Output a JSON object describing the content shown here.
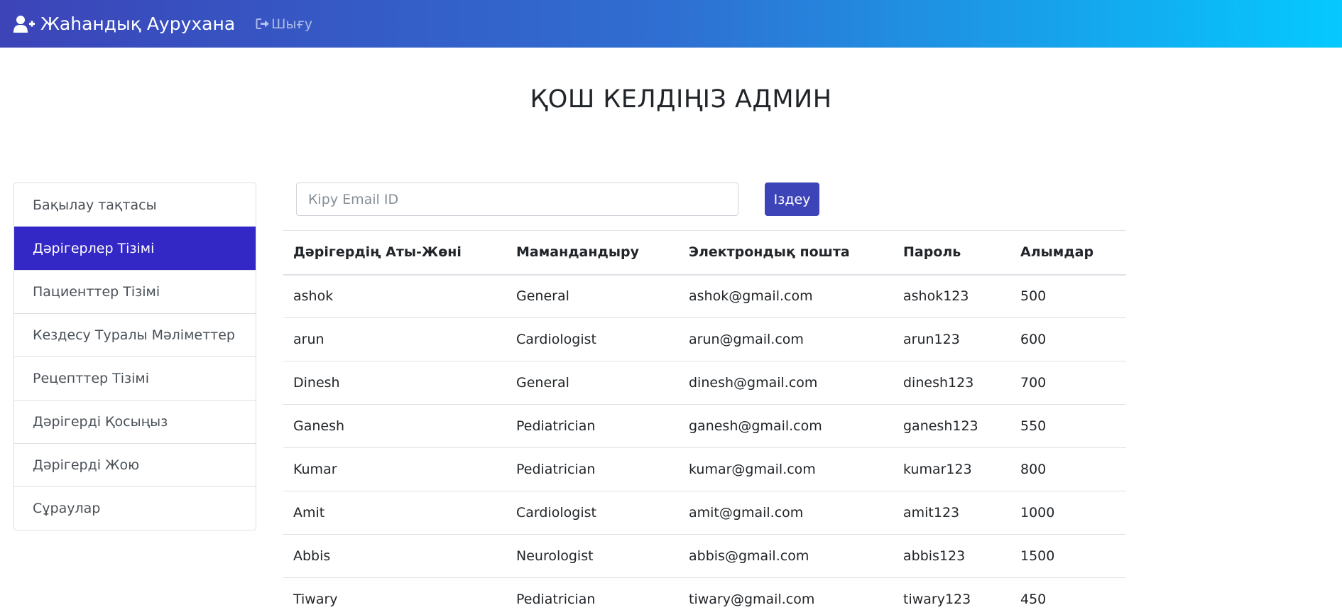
{
  "navbar": {
    "brand": "Жаһандық Аурухана",
    "logout": "Шығу"
  },
  "welcome": "ҚОШ КЕЛДІҢІЗ АДМИН",
  "sidebar": {
    "items": [
      {
        "label": "Бақылау тақтасы",
        "active": false
      },
      {
        "label": "Дәрігерлер Тізімі",
        "active": true
      },
      {
        "label": "Пациенттер Тізімі",
        "active": false
      },
      {
        "label": "Кездесу Туралы Мәліметтер",
        "active": false
      },
      {
        "label": "Рецепттер Тізімі",
        "active": false
      },
      {
        "label": "Дәрігерді Қосыңыз",
        "active": false
      },
      {
        "label": "Дәрігерді Жою",
        "active": false
      },
      {
        "label": "Сұраулар",
        "active": false
      }
    ]
  },
  "search": {
    "placeholder": "Кіру Email ID",
    "value": "",
    "button": "Іздеу"
  },
  "table": {
    "headers": [
      "Дәрігердің Аты-Жөні",
      "Мамандандыру",
      "Электрондық пошта",
      "Пароль",
      "Алымдар"
    ],
    "rows": [
      [
        "ashok",
        "General",
        "ashok@gmail.com",
        "ashok123",
        "500"
      ],
      [
        "arun",
        "Cardiologist",
        "arun@gmail.com",
        "arun123",
        "600"
      ],
      [
        "Dinesh",
        "General",
        "dinesh@gmail.com",
        "dinesh123",
        "700"
      ],
      [
        "Ganesh",
        "Pediatrician",
        "ganesh@gmail.com",
        "ganesh123",
        "550"
      ],
      [
        "Kumar",
        "Pediatrician",
        "kumar@gmail.com",
        "kumar123",
        "800"
      ],
      [
        "Amit",
        "Cardiologist",
        "amit@gmail.com",
        "amit123",
        "1000"
      ],
      [
        "Abbis",
        "Neurologist",
        "abbis@gmail.com",
        "abbis123",
        "1500"
      ],
      [
        "Tiwary",
        "Pediatrician",
        "tiwary@gmail.com",
        "tiwary123",
        "450"
      ]
    ]
  },
  "colors": {
    "navbar_start": "#3c44b8",
    "navbar_end": "#05c9ff",
    "active_item": "#3327c6",
    "button": "#3c44b8"
  },
  "icons": {
    "brand": "user-plus-icon",
    "logout": "sign-out-icon"
  }
}
